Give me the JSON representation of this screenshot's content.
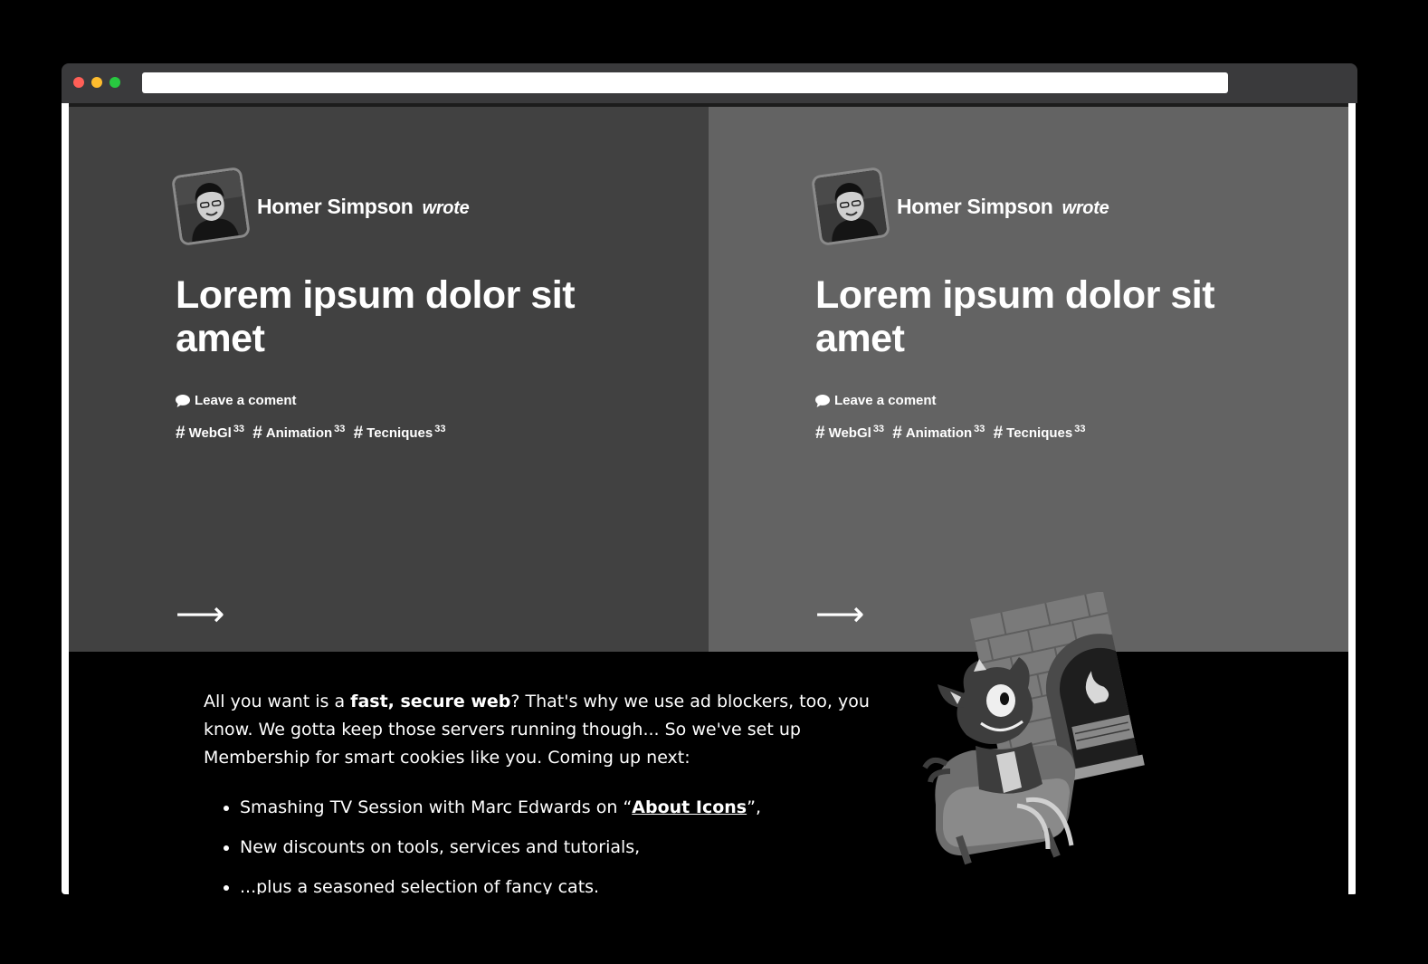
{
  "browser": {
    "url": ""
  },
  "cards": [
    {
      "author": "Homer Simpson",
      "wrote": "wrote",
      "title": "Lorem ipsum dolor sit amet",
      "comment_label": "Leave a coment",
      "tags": [
        {
          "label": "WebGl",
          "count": "33"
        },
        {
          "label": "Animation",
          "count": "33"
        },
        {
          "label": "Tecniques",
          "count": "33"
        }
      ],
      "arrow": "⟶",
      "background": "#414141"
    },
    {
      "author": "Homer Simpson",
      "wrote": "wrote",
      "title": "Lorem ipsum dolor sit amet",
      "comment_label": "Leave a coment",
      "tags": [
        {
          "label": "WebGl",
          "count": "33"
        },
        {
          "label": "Animation",
          "count": "33"
        },
        {
          "label": "Tecniques",
          "count": "33"
        }
      ],
      "arrow": "⟶",
      "background": "#636363"
    }
  ],
  "promo": {
    "intro_prefix": "All you want is a ",
    "intro_bold": "fast, secure web",
    "intro_suffix": "? That's why we use ad blockers, too, you know. We gotta keep those servers running though... So we've set up Membership for smart cookies like you. Coming up next:",
    "items": [
      {
        "prefix": "Smashing TV Session with Marc Edwards on “",
        "link": "About Icons",
        "suffix": "”,"
      },
      {
        "text": "New discounts on tools, services and tutorials,"
      },
      {
        "text": "...plus a seasoned selection of fancy cats."
      }
    ]
  },
  "icons": {
    "comment": "speech-bubble-icon",
    "hash": "hash-icon",
    "arrow": "arrow-right-icon",
    "illustration": "cat-by-fireplace-illustration"
  },
  "colors": {
    "page_bg": "#000000",
    "titlebar": "#3a3a3c",
    "traffic_red": "#ff5f57",
    "traffic_yellow": "#febc2e",
    "traffic_green": "#28c840"
  }
}
